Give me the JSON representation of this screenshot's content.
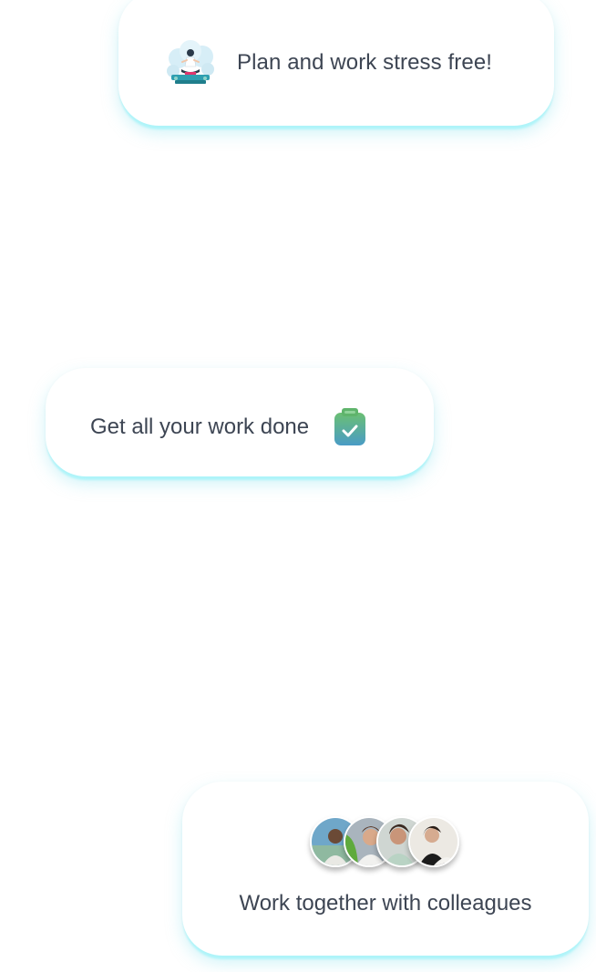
{
  "cards": {
    "stress_free": {
      "text": "Plan and work stress free!",
      "icon": "meditation-icon"
    },
    "work_done": {
      "text": "Get all your work done",
      "icon": "clipboard-check-icon"
    },
    "colleagues": {
      "text": "Work together with colleagues",
      "icon": "avatars-group",
      "avatar_count": 4
    }
  },
  "colors": {
    "text": "#3d4553",
    "card_glow": "#a0f4fa",
    "clipboard_top": "#6bbf73",
    "clipboard_bottom": "#4a9cc6",
    "check": "#ffffff"
  }
}
